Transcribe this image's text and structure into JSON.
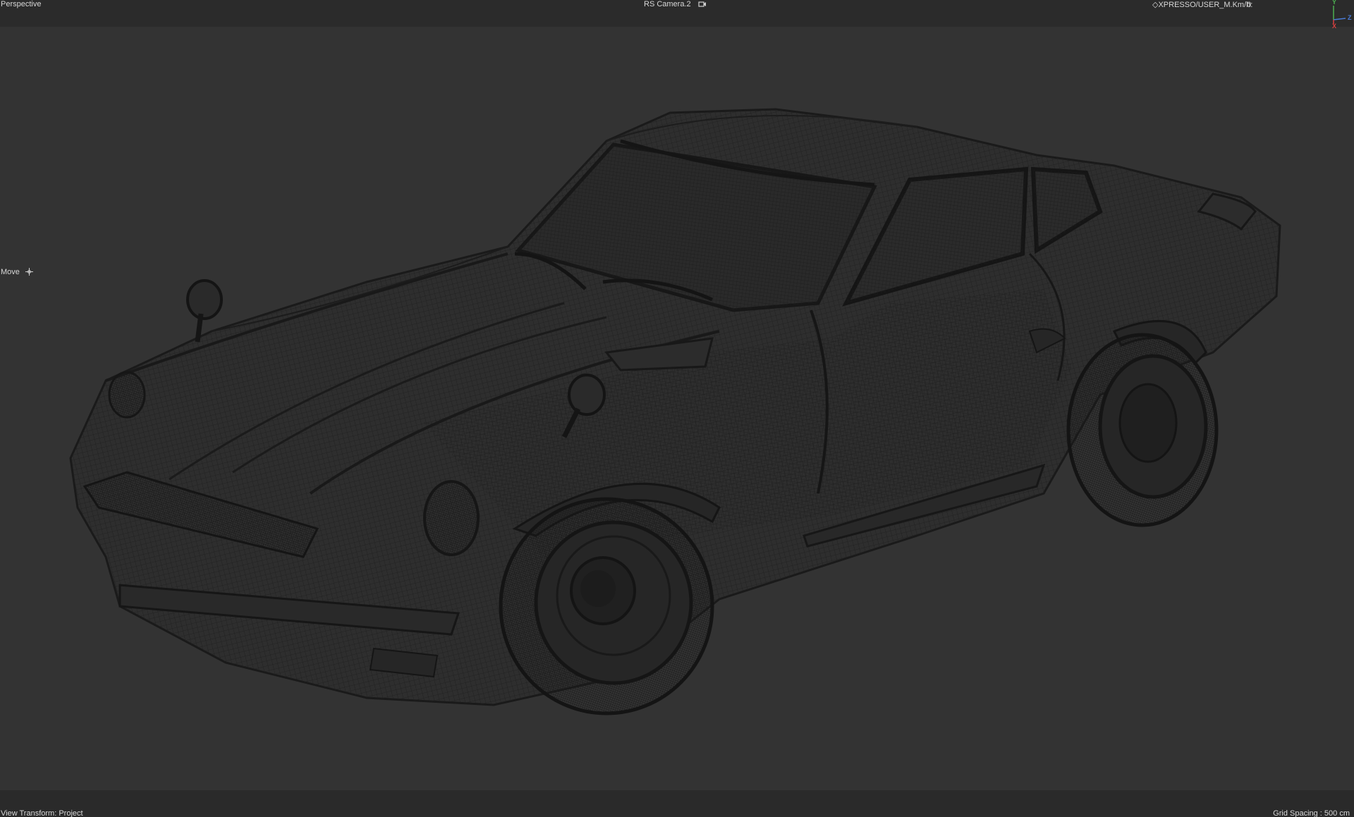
{
  "viewport": {
    "view_name": "Perspective",
    "camera_name": "RS Camera.2",
    "camera_icon": "camera-link-icon",
    "xpresso_label": "◇XPRESSO/USER_M.Km/h:",
    "xpresso_value": "0",
    "tool_label": "Move",
    "tool_icon": "move-crosshair-icon",
    "view_transform": "View Transform: Project",
    "grid_spacing": "Grid Spacing : 500 cm",
    "axis_labels": {
      "y": "Y",
      "z": "Z",
      "x": "X"
    },
    "colors": {
      "background": "#333333",
      "hud_bar": "#2b2b2b",
      "wireframe": "#1c1c1c",
      "axis_y": "#4caf50",
      "axis_z": "#4a7bd6",
      "axis_x": "#d94040"
    }
  }
}
